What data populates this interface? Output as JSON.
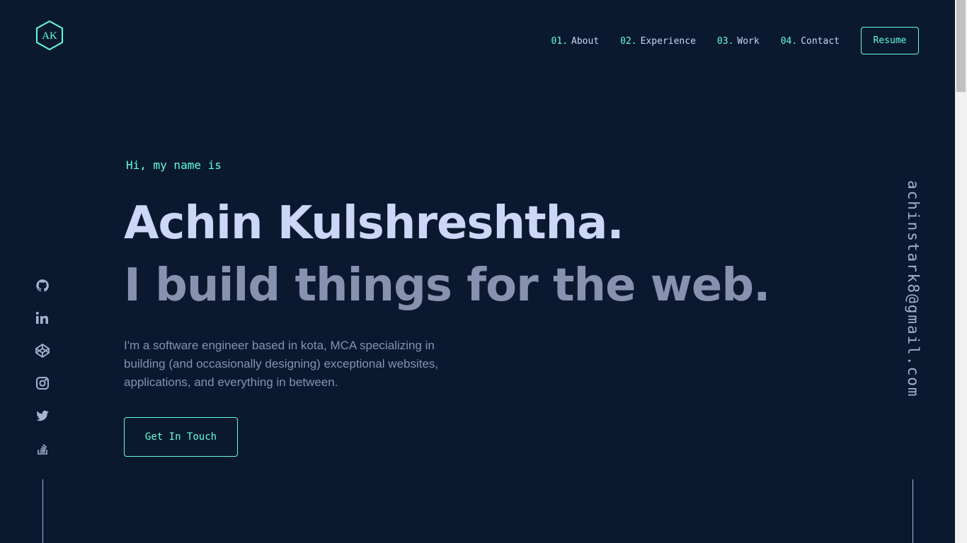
{
  "logo": {
    "text": "AK",
    "icon": "hexagon-logo-icon",
    "color": "#64ffda"
  },
  "nav": {
    "items": [
      {
        "num": "01.",
        "label": "About"
      },
      {
        "num": "02.",
        "label": "Experience"
      },
      {
        "num": "03.",
        "label": "Work"
      },
      {
        "num": "04.",
        "label": "Contact"
      }
    ],
    "resume_label": "Resume"
  },
  "hero": {
    "greeting": "Hi, my name is",
    "name": "Achin Kulshreshtha.",
    "tagline": "I build things for the web.",
    "bio": "I'm a software engineer based in kota, MCA specializing in building (and occasionally designing) exceptional websites, applications, and everything in between.",
    "cta_label": "Get In Touch"
  },
  "social": {
    "icons": [
      "github-icon",
      "linkedin-icon",
      "codepen-icon",
      "instagram-icon",
      "twitter-icon",
      "stackoverflow-icon"
    ]
  },
  "email": "achinstark8@gmail.com",
  "colors": {
    "background": "#0a192f",
    "accent": "#64ffda",
    "heading": "#ccd6f6",
    "text": "#8892b0"
  }
}
